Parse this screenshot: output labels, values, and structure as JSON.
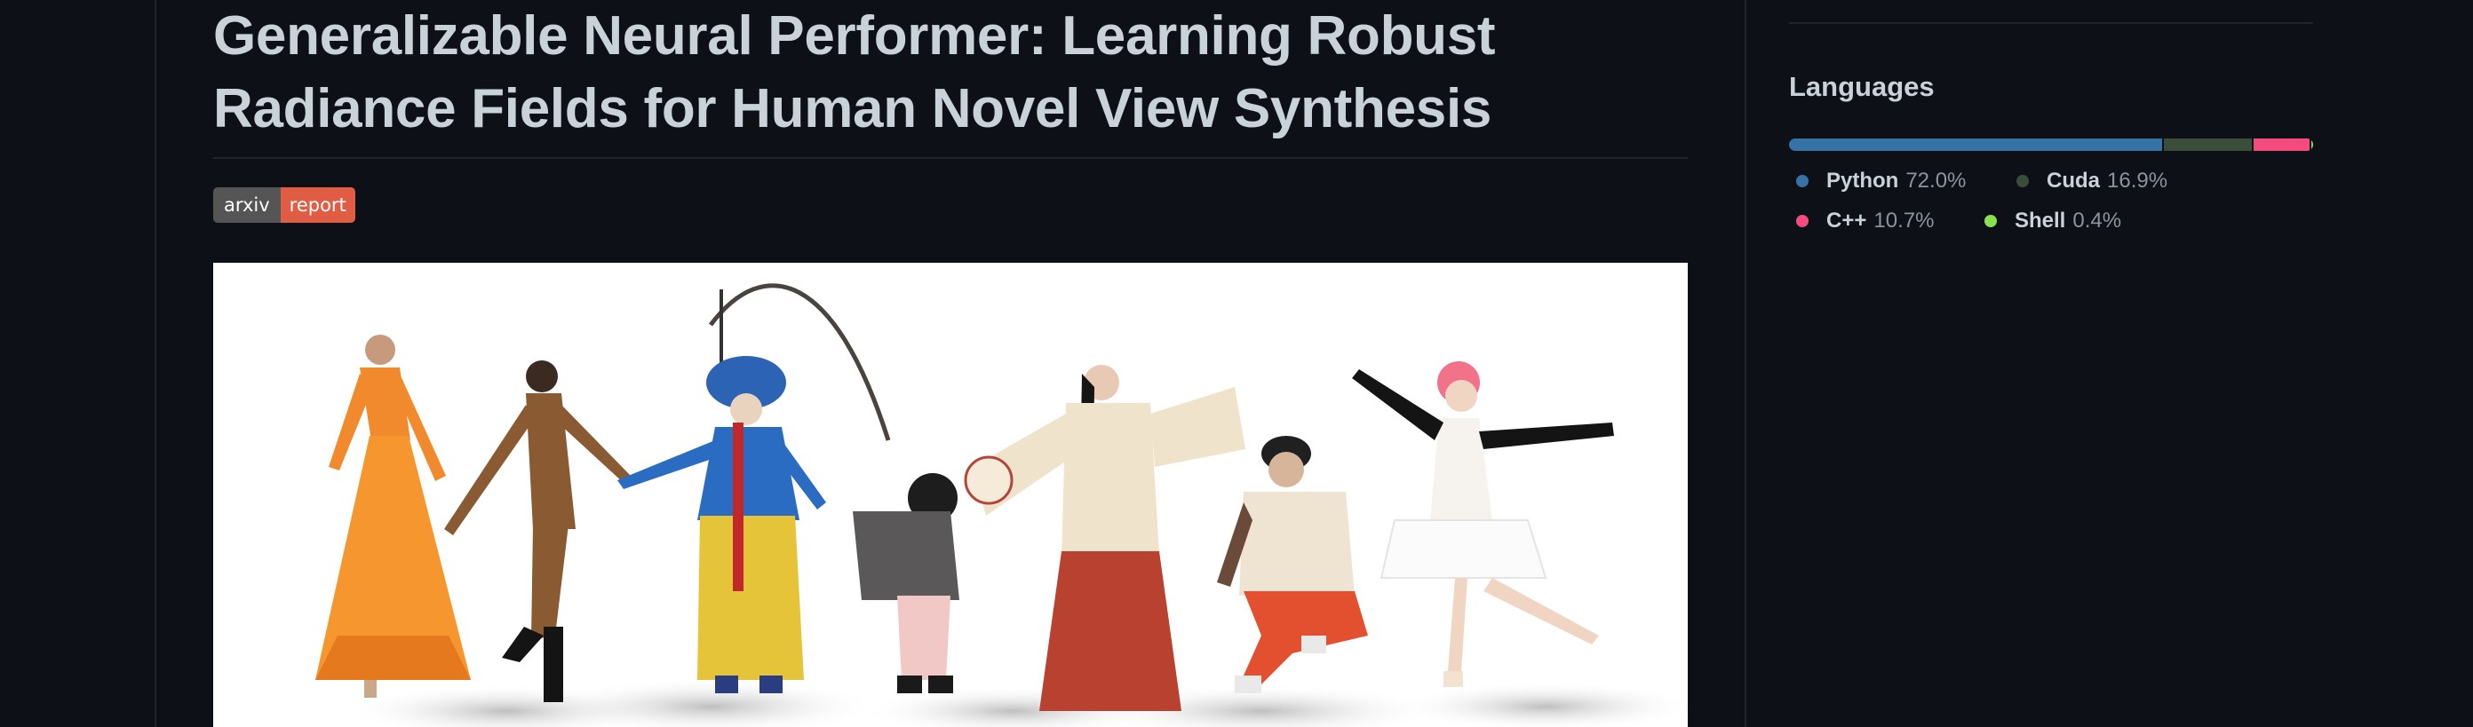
{
  "readme": {
    "title_line1": "Generalizable Neural Performer: Learning Robust",
    "title_line2": "Radiance Fields for Human Novel View Synthesis",
    "badge": {
      "left": "arxiv",
      "right": "report"
    }
  },
  "sidebar": {
    "languages": {
      "title": "Languages",
      "items": [
        {
          "name": "Python",
          "percent": "72.0%",
          "value": 72.0,
          "color": "#3572A5"
        },
        {
          "name": "Cuda",
          "percent": "16.9%",
          "value": 16.9,
          "color": "#3A4E3A"
        },
        {
          "name": "C++",
          "percent": "10.7%",
          "value": 10.7,
          "color": "#f34b7d"
        },
        {
          "name": "Shell",
          "percent": "0.4%",
          "value": 0.4,
          "color": "#89e051"
        }
      ]
    }
  }
}
